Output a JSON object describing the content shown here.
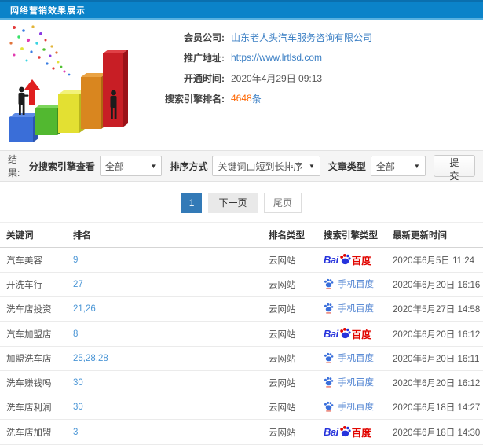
{
  "header": {
    "title": "网络营销效果展示"
  },
  "info": {
    "fields": [
      {
        "label": "会员公司:",
        "value": "山东老人头汽车服务咨询有限公司"
      },
      {
        "label": "推广地址:",
        "value": "https://www.lrtlsd.com"
      },
      {
        "label": "开通时间:",
        "value": "2020年4月29日 09:13"
      },
      {
        "label": "搜索引擎排名:",
        "value": "4648",
        "suffix": "条"
      }
    ]
  },
  "filters": {
    "result_label": "结果:",
    "engine_label": "分搜索引擎查看",
    "engine_value": "全部",
    "sort_label": "排序方式",
    "sort_value": "关键词由短到长排序",
    "article_label": "文章类型",
    "article_value": "全部",
    "submit_label": "提交",
    "caret": "▼"
  },
  "pagination": {
    "current": "1",
    "next": "下一页",
    "last": "尾页"
  },
  "table": {
    "headers": [
      "关键词",
      "排名",
      "排名类型",
      "搜索引擎类型",
      "最新更新时间"
    ],
    "rows": [
      {
        "keyword": "汽车美容",
        "rank": "9",
        "rank_type": "云网站",
        "engine": "baidu",
        "updated": "2020年6月5日 11:24"
      },
      {
        "keyword": "开洗车行",
        "rank": "27",
        "rank_type": "云网站",
        "engine": "mobile_baidu",
        "updated": "2020年6月20日 16:16"
      },
      {
        "keyword": "洗车店投资",
        "rank": "21,26",
        "rank_type": "云网站",
        "engine": "mobile_baidu",
        "updated": "2020年5月27日 14:58"
      },
      {
        "keyword": "汽车加盟店",
        "rank": "8",
        "rank_type": "云网站",
        "engine": "baidu",
        "updated": "2020年6月20日 16:12"
      },
      {
        "keyword": "加盟洗车店",
        "rank": "25,28,28",
        "rank_type": "云网站",
        "engine": "mobile_baidu",
        "updated": "2020年6月20日 16:11"
      },
      {
        "keyword": "洗车赚钱吗",
        "rank": "30",
        "rank_type": "云网站",
        "engine": "mobile_baidu",
        "updated": "2020年6月20日 16:12"
      },
      {
        "keyword": "洗车店利润",
        "rank": "30",
        "rank_type": "云网站",
        "engine": "mobile_baidu",
        "updated": "2020年6月18日 14:27"
      },
      {
        "keyword": "洗车店加盟",
        "rank": "3",
        "rank_type": "云网站",
        "engine": "baidu",
        "updated": "2020年6月18日 14:30"
      }
    ]
  },
  "engines": {
    "baidu": {
      "text_left": "Bai",
      "text_right": "百度"
    },
    "mobile_baidu": {
      "label": "手机百度"
    }
  },
  "colors": {
    "topbar_blue": "#0b83c9",
    "link_blue": "#3b7fc4",
    "rank_link_blue": "#4b96d6",
    "highlight_orange": "#ff6600",
    "pagination_active": "#337ab7",
    "baidu_blue": "#2633dc",
    "baidu_red": "#e10500",
    "filter_bar_bg": "#f5f5f5"
  }
}
